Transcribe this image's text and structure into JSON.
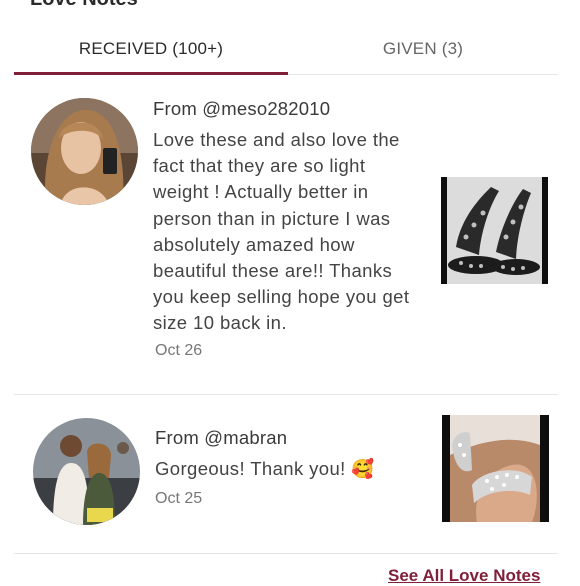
{
  "section_title": "Love Notes",
  "tabs": [
    {
      "label": "RECEIVED (100+)",
      "active": true
    },
    {
      "label": "GIVEN (3)",
      "active": false
    }
  ],
  "notes": [
    {
      "from": "From @meso282010",
      "text": "Love these and also love the fact that they are so light weight ! Actually better in person than in picture I was absolutely amazed how beautiful these are!! Thanks you keep selling hope you get size 10 back in.",
      "date": "Oct 26",
      "avatar_icon": "user-photo-avatar",
      "thumb_icon": "studded-sandals-photo"
    },
    {
      "from": "From @mabran",
      "text": "Gorgeous! Thank you! 🥰",
      "date": "Oct 25",
      "avatar_icon": "couple-photo-avatar",
      "thumb_icon": "jeweled-slides-photo"
    }
  ],
  "see_all_label": "See All Love Notes",
  "colors": {
    "accent": "#7f1f38",
    "divider": "#e6e6e6"
  }
}
